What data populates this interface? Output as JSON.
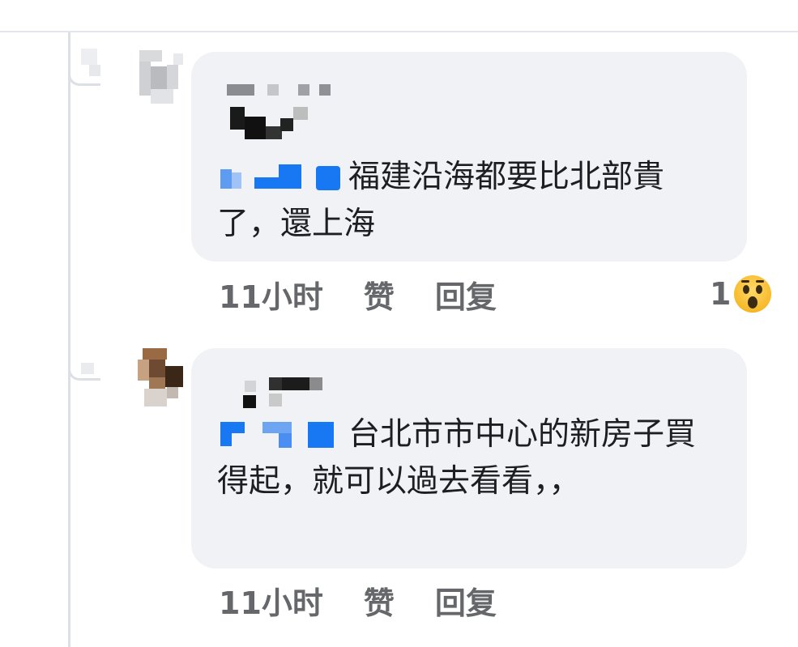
{
  "comments": [
    {
      "text_after_mention": "福建沿海都要比北部貴了，還上海",
      "time": "11小时",
      "like_label": "赞",
      "reply_label": "回复",
      "reaction": {
        "count": "1",
        "icon": "wow-emoji-icon"
      }
    },
    {
      "text_after_mention": "台北市市中心的新房子買得起，就可以過去看看，，",
      "time": "11小时",
      "like_label": "赞",
      "reply_label": "回复"
    }
  ],
  "colors": {
    "bubble": "#f0f2f5",
    "meta_text": "#65676b",
    "body_text": "#1c1e21",
    "mention_blue": "#1877f2"
  }
}
